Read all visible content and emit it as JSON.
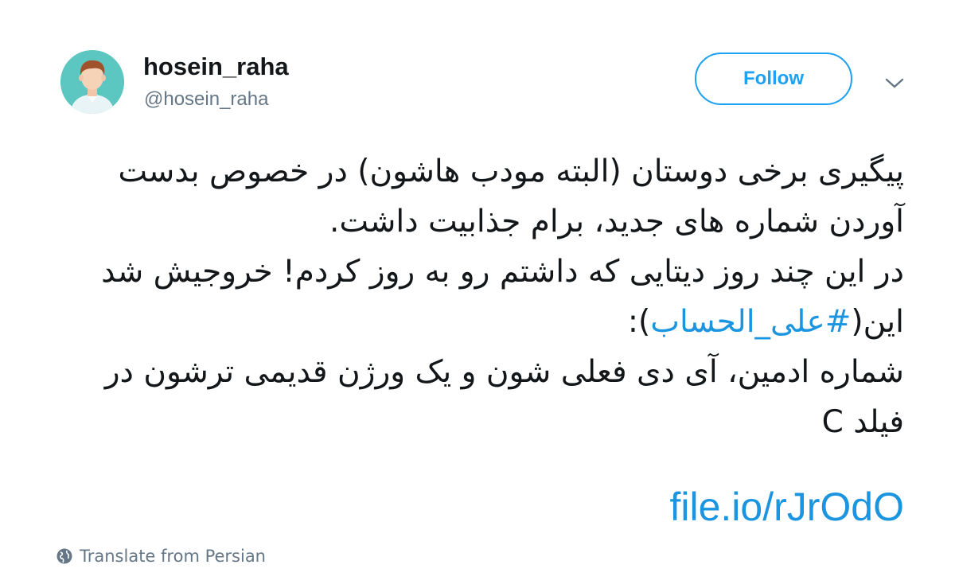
{
  "user": {
    "display_name": "hosein_raha",
    "handle": "@hosein_raha"
  },
  "follow_button": {
    "label": "Follow"
  },
  "menu": {
    "caret_icon": "chevron-down-icon"
  },
  "tweet": {
    "line1": "پیگیری برخی دوستان (البته مودب هاشون) در خصوص بدست آوردن شماره های جدید، برام جذابیت داشت.",
    "line2": "در این چند روز دیتایی که داشتم رو به روز کردم! خروجیش شد این(",
    "hashtag": "#علی_الحساب",
    "line2_end": "):",
    "line3": "شماره ادمین، آی دی فعلی شون و یک ورژن قدیمی ترشون در فیلد C",
    "link": "file.io/rJrOdO"
  },
  "translate": {
    "label": "Translate from Persian",
    "icon": "globe-icon"
  },
  "colors": {
    "accent": "#1da1f2",
    "link": "#1b95e0",
    "text": "#14171a",
    "secondary": "#657786",
    "avatar_bg": "#5cc6c0"
  }
}
